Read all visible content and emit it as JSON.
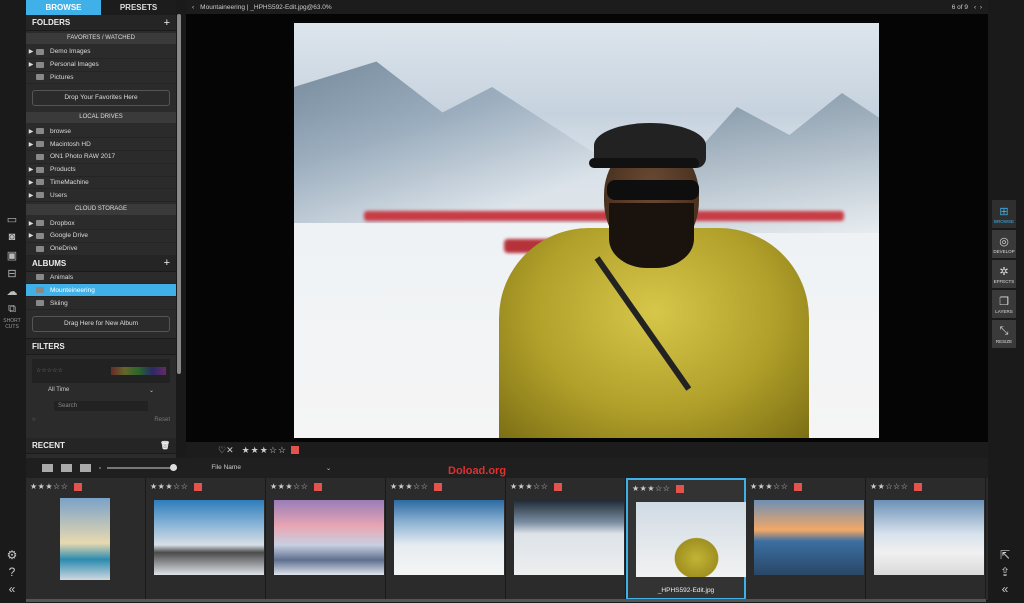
{
  "browser": {
    "tabs": [
      "BROWSE",
      "PRESETS"
    ],
    "folders_title": "FOLDERS",
    "favorites_title": "FAVORITES / WATCHED",
    "favorites": [
      "Demo Images",
      "Personal Images",
      "Pictures"
    ],
    "favorites_drop": "Drop Your Favorites Here",
    "drives_title": "LOCAL DRIVES",
    "drives": [
      "browse",
      "Macintosh HD",
      "ON1 Photo RAW 2017",
      "Products",
      "TimeMachine",
      "Users"
    ],
    "cloud_title": "CLOUD STORAGE",
    "cloud": [
      "Dropbox",
      "Google Drive",
      "OneDrive"
    ],
    "albums_title": "ALBUMS",
    "albums": [
      "Animals",
      "Mounteineering",
      "Skiing"
    ],
    "album_drop": "Drag Here for New Album",
    "filters_title": "FILTERS",
    "time_filter": "All Time",
    "search_placeholder": "Search",
    "reset": "Reset",
    "recent_title": "RECENT"
  },
  "topbar": {
    "breadcrumb": "Mountaineering  |  _HPHS592-Edit.jpg@63.0%",
    "count": "6 of 9"
  },
  "left_tools": [
    "monitor-icon",
    "camera-icon",
    "folder-icon",
    "drive-icon",
    "cloud-icon",
    "shortcuts-icon"
  ],
  "left_tools_label": "SHORT CUTS",
  "right_tools": [
    {
      "icon": "browse-icon",
      "label": "BROWSE"
    },
    {
      "icon": "develop-icon",
      "label": "DEVELOP"
    },
    {
      "icon": "effects-icon",
      "label": "EFFECTS"
    },
    {
      "icon": "layers-icon",
      "label": "LAYERS"
    },
    {
      "icon": "resize-icon",
      "label": "RESIZE"
    }
  ],
  "ratebar": {
    "reject": "♡✕",
    "stars": "★★★☆☆",
    "color_label": "#e4534b"
  },
  "filmstrip": {
    "sort_label": "File Name",
    "watermark": "Doload.org",
    "items": [
      {
        "stars": "★★★☆☆",
        "thumb": "t1"
      },
      {
        "stars": "★★★☆☆",
        "thumb": "t2"
      },
      {
        "stars": "★★★☆☆",
        "thumb": "t3"
      },
      {
        "stars": "★★★☆☆",
        "thumb": "t4"
      },
      {
        "stars": "★★★☆☆",
        "thumb": "t5"
      },
      {
        "stars": "★★★☆☆",
        "thumb": "t6",
        "selected": true,
        "name": "_HPHS592-Edit.jpg"
      },
      {
        "stars": "★★★☆☆",
        "thumb": "t7"
      },
      {
        "stars": "★★☆☆☆",
        "thumb": "t8"
      }
    ]
  },
  "colors": {
    "accent": "#3fb1e8",
    "label_red": "#e4534b",
    "panel": "#2b2b2b"
  }
}
